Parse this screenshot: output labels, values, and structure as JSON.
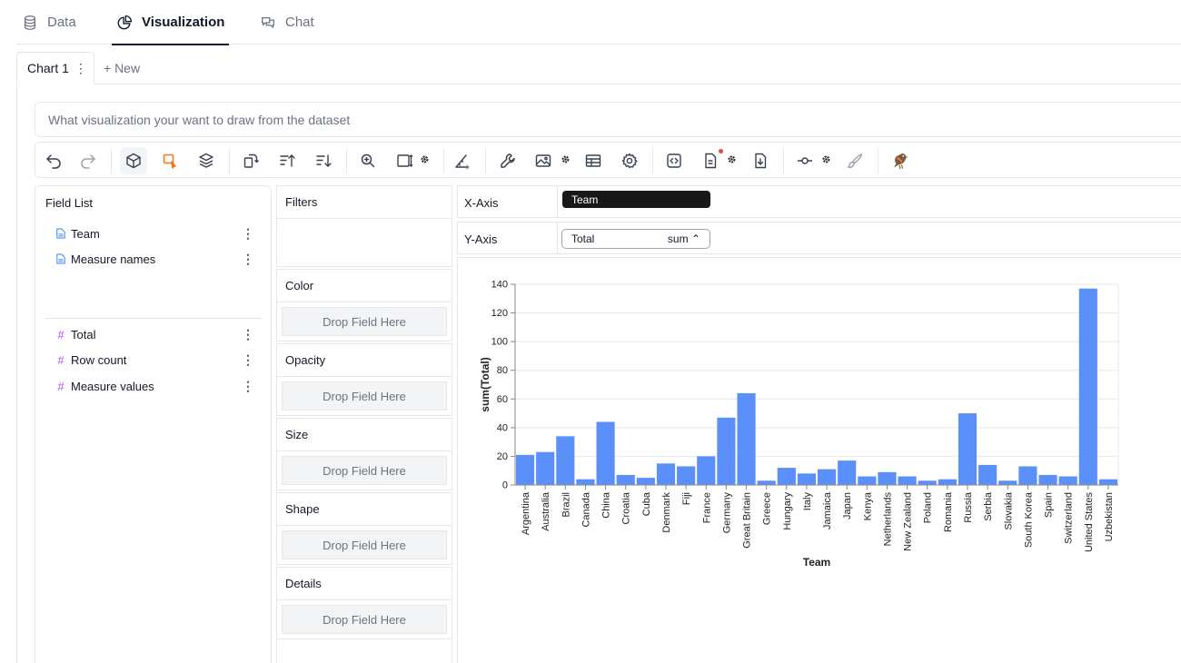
{
  "tabs": [
    {
      "label": "Data",
      "icon": "database-icon"
    },
    {
      "label": "Visualization",
      "icon": "pie-chart-icon"
    },
    {
      "label": "Chat",
      "icon": "chat-icon"
    }
  ],
  "chart_tabs": {
    "current": "Chart 1",
    "new": "+ New"
  },
  "prompt": {
    "placeholder": "What visualization your want to draw from the dataset"
  },
  "toolbar": {
    "icons": [
      "undo-icon",
      "redo-icon",
      "cube-icon",
      "brush-select-icon",
      "layers-icon",
      "transpose-icon",
      "sort-ascending-icon",
      "sort-descending-icon",
      "zoom-icon",
      "resize-icon",
      "axis-scale-icon",
      "wrench-icon",
      "image-icon",
      "table-icon",
      "settings-icon",
      "code-icon",
      "export-doc-icon",
      "download-icon",
      "line-marker-icon",
      "paint-brush-icon",
      "bird-logo-icon"
    ],
    "accent_color": "#f97316"
  },
  "field_list": {
    "title": "Field List",
    "dimensions": [
      "Team",
      "Measure names"
    ],
    "measures": [
      "Total",
      "Row count",
      "Measure values"
    ]
  },
  "encodings": {
    "filters": "Filters",
    "drop_placeholder": "Drop Field Here",
    "channels": [
      "Color",
      "Opacity",
      "Size",
      "Shape",
      "Details"
    ]
  },
  "axes": {
    "x_label": "X-Axis",
    "x_field": "Team",
    "y_label": "Y-Axis",
    "y_field": "Total",
    "y_agg": "sum"
  },
  "chart_data": {
    "type": "bar",
    "xlabel": "Team",
    "ylabel": "sum(Total)",
    "ylim": [
      0,
      140
    ],
    "yticks": [
      0,
      20,
      40,
      60,
      80,
      100,
      120,
      140
    ],
    "grid": true,
    "bar_color": "#5b8ff9",
    "categories": [
      "Argentina",
      "Australia",
      "Brazil",
      "Canada",
      "China",
      "Croatia",
      "Cuba",
      "Denmark",
      "Fiji",
      "France",
      "Germany",
      "Great Britain",
      "Greece",
      "Hungary",
      "Italy",
      "Jamaica",
      "Japan",
      "Kenya",
      "Netherlands",
      "New Zealand",
      "Poland",
      "Romania",
      "Russia",
      "Serbia",
      "Slovakia",
      "South Korea",
      "Spain",
      "Switzerland",
      "United States",
      "Uzbekistan"
    ],
    "values": [
      21,
      23,
      34,
      4,
      44,
      7,
      5,
      15,
      13,
      20,
      47,
      64,
      3,
      12,
      8,
      11,
      17,
      6,
      9,
      6,
      3,
      4,
      50,
      14,
      3,
      13,
      7,
      6,
      137,
      4
    ]
  }
}
